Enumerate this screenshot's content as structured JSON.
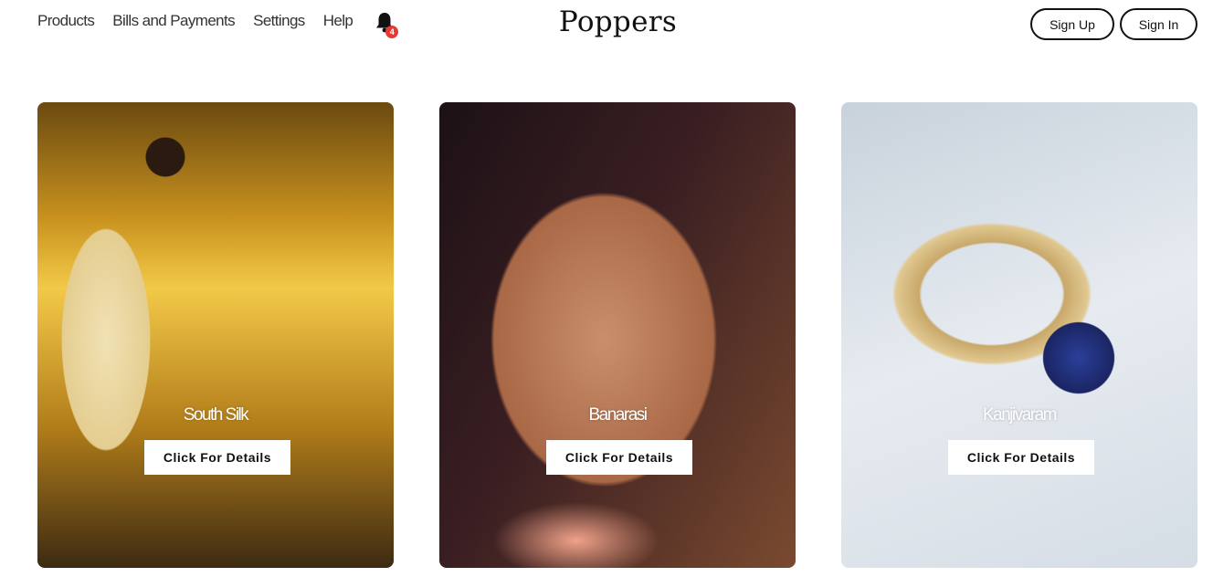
{
  "nav": {
    "items": [
      "Products",
      "Bills and Payments",
      "Settings",
      "Help"
    ],
    "notification_count": "4"
  },
  "brand": {
    "name": "Poppers"
  },
  "auth": {
    "sign_up": "Sign Up",
    "sign_in": "Sign In"
  },
  "cards": [
    {
      "title": "South Silk",
      "button": "Click For Details"
    },
    {
      "title": "Banarasi",
      "button": "Click For Details"
    },
    {
      "title": "Kanjivaram",
      "button": "Click For Details"
    }
  ],
  "colors": {
    "badge": "#e53935",
    "text": "#222222",
    "background": "#ffffff"
  },
  "icons": {
    "notification": "bell-icon"
  }
}
